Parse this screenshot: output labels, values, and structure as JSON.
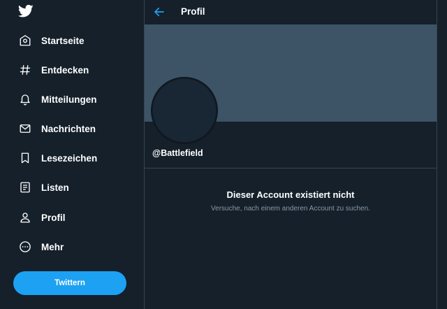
{
  "sidebar": {
    "logo_icon": "twitter-bird-icon",
    "items": [
      {
        "label": "Startseite",
        "icon": "home-icon"
      },
      {
        "label": "Entdecken",
        "icon": "hashtag-icon"
      },
      {
        "label": "Mitteilungen",
        "icon": "bell-icon"
      },
      {
        "label": "Nachrichten",
        "icon": "mail-icon"
      },
      {
        "label": "Lesezeichen",
        "icon": "bookmark-icon"
      },
      {
        "label": "Listen",
        "icon": "list-icon"
      },
      {
        "label": "Profil",
        "icon": "person-icon"
      },
      {
        "label": "Mehr",
        "icon": "more-icon"
      }
    ],
    "tweet_button": "Twittern"
  },
  "header": {
    "back_icon": "arrow-left-icon",
    "title": "Profil"
  },
  "profile": {
    "handle": "@Battlefield"
  },
  "empty_state": {
    "title": "Dieser Account existiert nicht",
    "subtitle": "Versuche, nach einem anderen Account zu suchen."
  },
  "colors": {
    "background": "#15202b",
    "banner": "#3d5466",
    "accent": "#1da1f2",
    "secondary_text": "#8899a6",
    "border": "#38444d"
  }
}
